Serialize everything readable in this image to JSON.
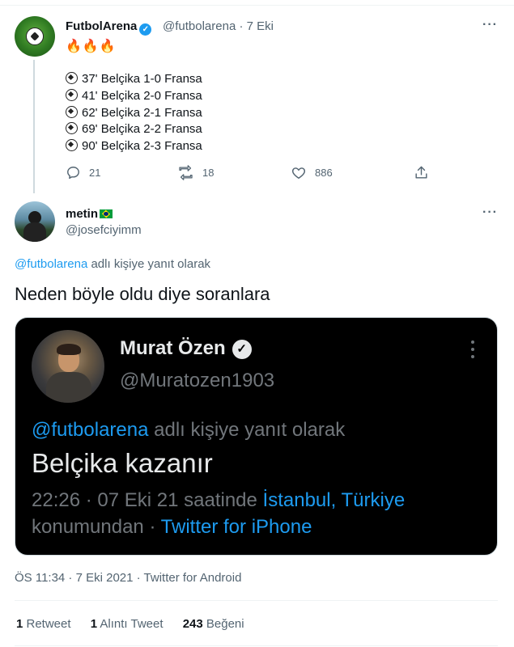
{
  "parent_tweet": {
    "author_name": "FutbolArena",
    "handle_date": "@futbolarena · 7 Eki",
    "emoji_line": "🔥🔥🔥",
    "score_lines": [
      "37' Belçika 1-0 Fransa",
      "41' Belçika 2-0 Fransa",
      "62' Belçika 2-1 Fransa",
      "69' Belçika 2-2 Fransa",
      "90' Belçika 2-3 Fransa"
    ],
    "reply_count": "21",
    "retweet_count": "18",
    "like_count": "886",
    "more_label": "···"
  },
  "reply_tweet": {
    "author_name": "metin",
    "handle": "@josefciyimm",
    "reply_to_handle": "@futbolarena",
    "reply_to_suffix": " adlı kişiye yanıt olarak",
    "text": "Neden böyle oldu diye soranlara",
    "more_label": "···"
  },
  "embedded_screenshot": {
    "author_name": "Murat Özen",
    "handle": "@Muratozen1903",
    "reply_to_handle": "@futbolarena",
    "reply_to_suffix": " adlı kişiye yanıt olarak",
    "text": "Belçika kazanır",
    "meta_time": "22:26 · 07 Eki 21 saatinde ",
    "meta_location": "İstanbul, Türkiye",
    "meta_suffix": "konumundan · ",
    "meta_client": "Twitter for iPhone"
  },
  "timestamp": "ÖS 11:34 · 7 Eki 2021 · Twitter for Android",
  "stats": {
    "retweets_value": "1",
    "retweets_label": " Retweet",
    "quotes_value": "1",
    "quotes_label": " Alıntı Tweet",
    "likes_value": "243",
    "likes_label": " Beğeni"
  },
  "colors": {
    "link": "#1d9bf0",
    "muted": "#536471",
    "text": "#0f1419",
    "dark_bg": "#000000"
  },
  "icons": [
    "football-avatar-icon",
    "verified-badge-icon",
    "reply-icon",
    "retweet-icon",
    "like-icon",
    "share-icon",
    "more-icon",
    "brazil-flag-icon"
  ]
}
